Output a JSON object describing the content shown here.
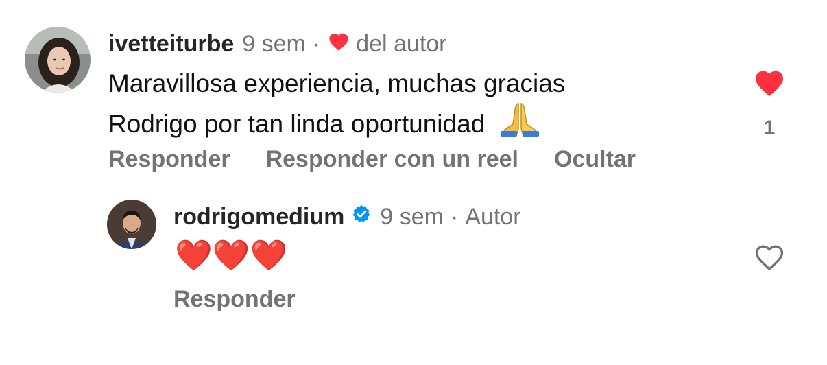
{
  "comments": [
    {
      "username": "ivetteiturbe",
      "time": "9 sem",
      "separator": "·",
      "author_like_label": "del autor",
      "text_line1": "Maravillosa experiencia, muchas gracias",
      "text_line2": "Rodrigo por tan linda oportunidad",
      "emoji": "🙏",
      "liked": true,
      "like_count": "1",
      "actions": [
        "Responder",
        "Responder con un reel",
        "Ocultar"
      ]
    },
    {
      "username": "rodrigomedium",
      "verified": true,
      "time": "9 sem",
      "separator": "·",
      "author_badge": "Autor",
      "text": "❤️❤️❤️",
      "liked": false,
      "actions": [
        "Responder"
      ]
    }
  ],
  "colors": {
    "like_red": "#ff3040",
    "verified_blue": "#0095f6",
    "muted_gray": "#737373"
  },
  "icons": [
    "heart-filled-icon",
    "heart-outline-icon",
    "verified-badge-icon",
    "praying-hands-emoji"
  ]
}
